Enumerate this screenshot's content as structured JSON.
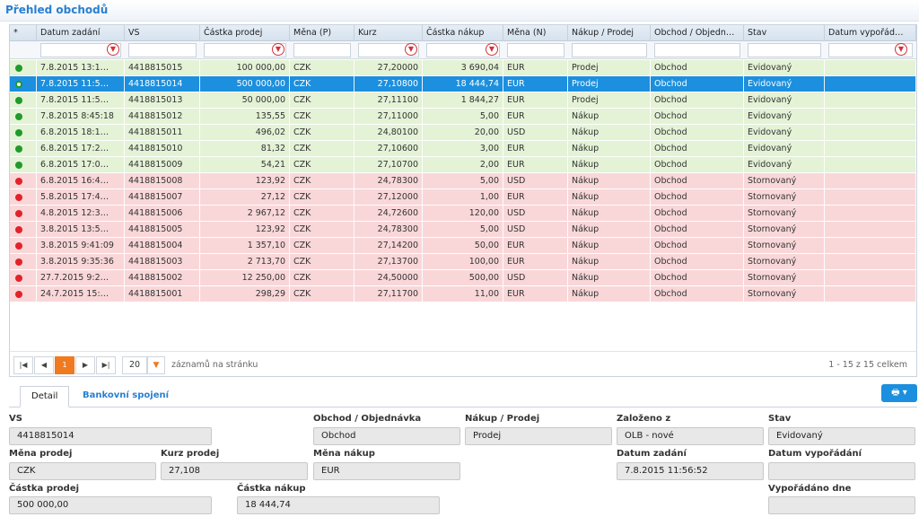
{
  "page": {
    "title": "Přehled obchodů"
  },
  "grid": {
    "columns": [
      "*",
      "Datum zadání",
      "VS",
      "Částka prodej",
      "Měna (P)",
      "Kurz",
      "Částka nákup",
      "Měna (N)",
      "Nákup / Prodej",
      "Obchod / Objedn…",
      "Stav",
      "Datum vypořád…"
    ],
    "rows": [
      {
        "status": "green",
        "datum": "7.8.2015 13:1…",
        "vs": "4418815015",
        "prodej": "100 000,00",
        "menap": "CZK",
        "kurz": "27,20000",
        "nakup": "3 690,04",
        "menan": "EUR",
        "np": "Prodej",
        "obchod": "Obchod",
        "stav": "Evidovaný"
      },
      {
        "status": "selected",
        "datum": "7.8.2015 11:5…",
        "vs": "4418815014",
        "prodej": "500 000,00",
        "menap": "CZK",
        "kurz": "27,10800",
        "nakup": "18 444,74",
        "menan": "EUR",
        "np": "Prodej",
        "obchod": "Obchod",
        "stav": "Evidovaný"
      },
      {
        "status": "green",
        "datum": "7.8.2015 11:5…",
        "vs": "4418815013",
        "prodej": "50 000,00",
        "menap": "CZK",
        "kurz": "27,11100",
        "nakup": "1 844,27",
        "menan": "EUR",
        "np": "Prodej",
        "obchod": "Obchod",
        "stav": "Evidovaný"
      },
      {
        "status": "green",
        "datum": "7.8.2015 8:45:18",
        "vs": "4418815012",
        "prodej": "135,55",
        "menap": "CZK",
        "kurz": "27,11000",
        "nakup": "5,00",
        "menan": "EUR",
        "np": "Nákup",
        "obchod": "Obchod",
        "stav": "Evidovaný"
      },
      {
        "status": "green",
        "datum": "6.8.2015 18:1…",
        "vs": "4418815011",
        "prodej": "496,02",
        "menap": "CZK",
        "kurz": "24,80100",
        "nakup": "20,00",
        "menan": "USD",
        "np": "Nákup",
        "obchod": "Obchod",
        "stav": "Evidovaný"
      },
      {
        "status": "green",
        "datum": "6.8.2015 17:2…",
        "vs": "4418815010",
        "prodej": "81,32",
        "menap": "CZK",
        "kurz": "27,10600",
        "nakup": "3,00",
        "menan": "EUR",
        "np": "Nákup",
        "obchod": "Obchod",
        "stav": "Evidovaný"
      },
      {
        "status": "green",
        "datum": "6.8.2015 17:0…",
        "vs": "4418815009",
        "prodej": "54,21",
        "menap": "CZK",
        "kurz": "27,10700",
        "nakup": "2,00",
        "menan": "EUR",
        "np": "Nákup",
        "obchod": "Obchod",
        "stav": "Evidovaný"
      },
      {
        "status": "red",
        "datum": "6.8.2015 16:4…",
        "vs": "4418815008",
        "prodej": "123,92",
        "menap": "CZK",
        "kurz": "24,78300",
        "nakup": "5,00",
        "menan": "USD",
        "np": "Nákup",
        "obchod": "Obchod",
        "stav": "Stornovaný"
      },
      {
        "status": "red",
        "datum": "5.8.2015 17:4…",
        "vs": "4418815007",
        "prodej": "27,12",
        "menap": "CZK",
        "kurz": "27,12000",
        "nakup": "1,00",
        "menan": "EUR",
        "np": "Nákup",
        "obchod": "Obchod",
        "stav": "Stornovaný"
      },
      {
        "status": "red",
        "datum": "4.8.2015 12:3…",
        "vs": "4418815006",
        "prodej": "2 967,12",
        "menap": "CZK",
        "kurz": "24,72600",
        "nakup": "120,00",
        "menan": "USD",
        "np": "Nákup",
        "obchod": "Obchod",
        "stav": "Stornovaný"
      },
      {
        "status": "red",
        "datum": "3.8.2015 13:5…",
        "vs": "4418815005",
        "prodej": "123,92",
        "menap": "CZK",
        "kurz": "24,78300",
        "nakup": "5,00",
        "menan": "USD",
        "np": "Nákup",
        "obchod": "Obchod",
        "stav": "Stornovaný"
      },
      {
        "status": "red",
        "datum": "3.8.2015 9:41:09",
        "vs": "4418815004",
        "prodej": "1 357,10",
        "menap": "CZK",
        "kurz": "27,14200",
        "nakup": "50,00",
        "menan": "EUR",
        "np": "Nákup",
        "obchod": "Obchod",
        "stav": "Stornovaný"
      },
      {
        "status": "red",
        "datum": "3.8.2015 9:35:36",
        "vs": "4418815003",
        "prodej": "2 713,70",
        "menap": "CZK",
        "kurz": "27,13700",
        "nakup": "100,00",
        "menan": "EUR",
        "np": "Nákup",
        "obchod": "Obchod",
        "stav": "Stornovaný"
      },
      {
        "status": "red",
        "datum": "27.7.2015 9:2…",
        "vs": "4418815002",
        "prodej": "12 250,00",
        "menap": "CZK",
        "kurz": "24,50000",
        "nakup": "500,00",
        "menan": "USD",
        "np": "Nákup",
        "obchod": "Obchod",
        "stav": "Stornovaný"
      },
      {
        "status": "red",
        "datum": "24.7.2015 15:…",
        "vs": "4418815001",
        "prodej": "298,29",
        "menap": "CZK",
        "kurz": "27,11700",
        "nakup": "11,00",
        "menan": "EUR",
        "np": "Nákup",
        "obchod": "Obchod",
        "stav": "Stornovaný"
      }
    ]
  },
  "pager": {
    "first": "|◀",
    "prev": "◀",
    "page": "1",
    "next": "▶",
    "last": "▶|",
    "page_size": "20",
    "page_size_label": "záznamů na stránku",
    "info": "1 - 15 z 15 celkem"
  },
  "tabs": {
    "detail": "Detail",
    "bank": "Bankovní spojení",
    "print_icon": "printer-icon"
  },
  "detail": {
    "vs_label": "VS",
    "vs": "4418815014",
    "obchod_label": "Obchod / Objednávka",
    "obchod": "Obchod",
    "nakup_prodej_label": "Nákup / Prodej",
    "nakup_prodej": "Prodej",
    "zalozeno_label": "Založeno z",
    "zalozeno": "OLB - nové",
    "stav_label": "Stav",
    "stav": "Evidovaný",
    "mena_prodej_label": "Měna prodej",
    "mena_prodej": "CZK",
    "kurz_prodej_label": "Kurz prodej",
    "kurz_prodej": "27,108",
    "mena_nakup_label": "Měna nákup",
    "mena_nakup": "EUR",
    "datum_zadani_label": "Datum zadání",
    "datum_zadani": "7.8.2015 11:56:52",
    "datum_vyporadani_label": "Datum vypořádání",
    "datum_vyporadani": "",
    "castka_prodej_label": "Částka prodej",
    "castka_prodej": "500 000,00",
    "castka_nakup_label": "Částka nákup",
    "castka_nakup": "18 444,74",
    "vyporadano_label": "Vypořádáno dne",
    "vyporadano": ""
  }
}
